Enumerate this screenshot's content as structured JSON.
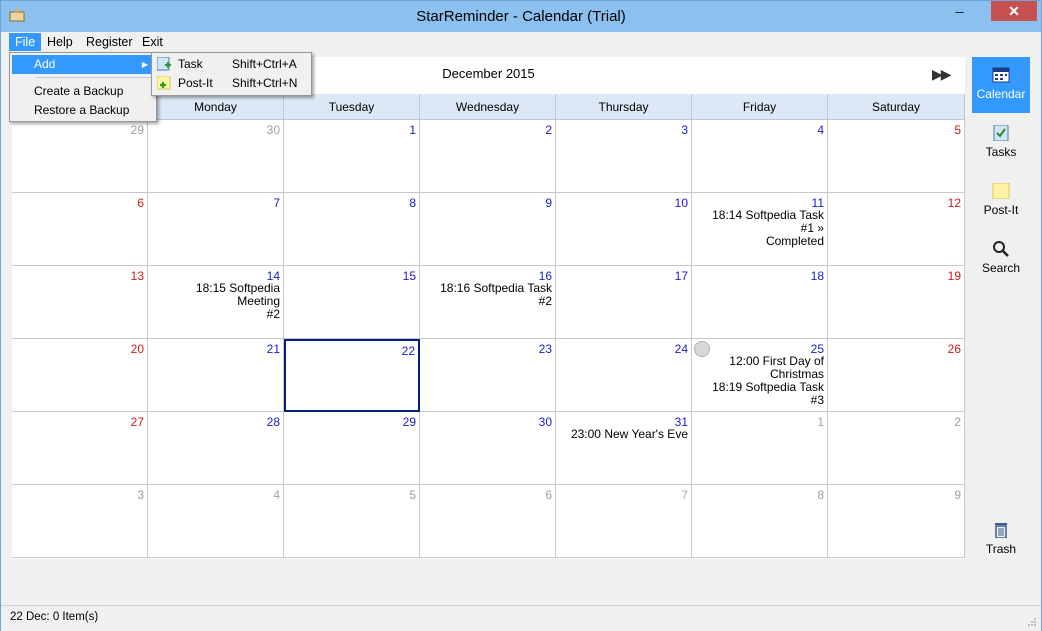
{
  "window": {
    "title": "StarReminder - Calendar  (Trial)"
  },
  "menu": {
    "file": "File",
    "help": "Help",
    "register": "Register",
    "exit": "Exit",
    "file_items": {
      "add": "Add",
      "create_backup": "Create a Backup",
      "restore_backup": "Restore a Backup"
    },
    "add_items": [
      {
        "label": "Task",
        "shortcut": "Shift+Ctrl+A",
        "icon": "task-add-icon"
      },
      {
        "label": "Post-It",
        "shortcut": "Shift+Ctrl+N",
        "icon": "postit-add-icon"
      }
    ]
  },
  "calendar": {
    "month": "December 2015",
    "weekdays": [
      "",
      "Monday",
      "Tuesday",
      "Wednesday",
      "Thursday",
      "Friday",
      "Saturday"
    ],
    "weeks": [
      [
        {
          "d": "29",
          "c": "gray"
        },
        {
          "d": "30",
          "c": "gray"
        },
        {
          "d": "1",
          "c": "blue"
        },
        {
          "d": "2",
          "c": "blue"
        },
        {
          "d": "3",
          "c": "blue"
        },
        {
          "d": "4",
          "c": "blue"
        },
        {
          "d": "5",
          "c": "red"
        }
      ],
      [
        {
          "d": "6",
          "c": "red"
        },
        {
          "d": "7",
          "c": "blue"
        },
        {
          "d": "8",
          "c": "blue"
        },
        {
          "d": "9",
          "c": "blue"
        },
        {
          "d": "10",
          "c": "blue"
        },
        {
          "d": "11",
          "c": "blue",
          "e": [
            "18:14 Softpedia Task #1 »",
            "Completed"
          ]
        },
        {
          "d": "12",
          "c": "red"
        }
      ],
      [
        {
          "d": "13",
          "c": "red"
        },
        {
          "d": "14",
          "c": "blue",
          "e": [
            "18:15 Softpedia Meeting",
            "#2"
          ]
        },
        {
          "d": "15",
          "c": "blue"
        },
        {
          "d": "16",
          "c": "blue",
          "e": [
            "18:16 Softpedia Task #2"
          ]
        },
        {
          "d": "17",
          "c": "blue"
        },
        {
          "d": "18",
          "c": "blue"
        },
        {
          "d": "19",
          "c": "red"
        }
      ],
      [
        {
          "d": "20",
          "c": "red"
        },
        {
          "d": "21",
          "c": "blue"
        },
        {
          "d": "22",
          "c": "blue",
          "today": true
        },
        {
          "d": "23",
          "c": "blue"
        },
        {
          "d": "24",
          "c": "blue"
        },
        {
          "d": "25",
          "c": "blue",
          "moon": true,
          "e": [
            "12:00 First Day of",
            "Christmas",
            "18:19 Softpedia Task #3"
          ]
        },
        {
          "d": "26",
          "c": "red"
        }
      ],
      [
        {
          "d": "27",
          "c": "red"
        },
        {
          "d": "28",
          "c": "blue"
        },
        {
          "d": "29",
          "c": "blue"
        },
        {
          "d": "30",
          "c": "blue"
        },
        {
          "d": "31",
          "c": "blue",
          "e": [
            "23:00 New Year's Eve"
          ]
        },
        {
          "d": "1",
          "c": "gray"
        },
        {
          "d": "2",
          "c": "gray"
        }
      ],
      [
        {
          "d": "3",
          "c": "gray"
        },
        {
          "d": "4",
          "c": "gray"
        },
        {
          "d": "5",
          "c": "gray"
        },
        {
          "d": "6",
          "c": "gray"
        },
        {
          "d": "7",
          "c": "gray"
        },
        {
          "d": "8",
          "c": "gray"
        },
        {
          "d": "9",
          "c": "gray"
        }
      ]
    ]
  },
  "sidebar": {
    "calendar": "Calendar",
    "tasks": "Tasks",
    "postit": "Post-It",
    "search": "Search",
    "trash": "Trash"
  },
  "status": {
    "text": "22 Dec: 0 Item(s)"
  },
  "colors": {
    "accent": "#3399ff",
    "weekday_date": "#1a1ad0",
    "weekend_date": "#d01a1a",
    "other_month": "#a0a0a0",
    "today_border": "#0a1f7a"
  }
}
